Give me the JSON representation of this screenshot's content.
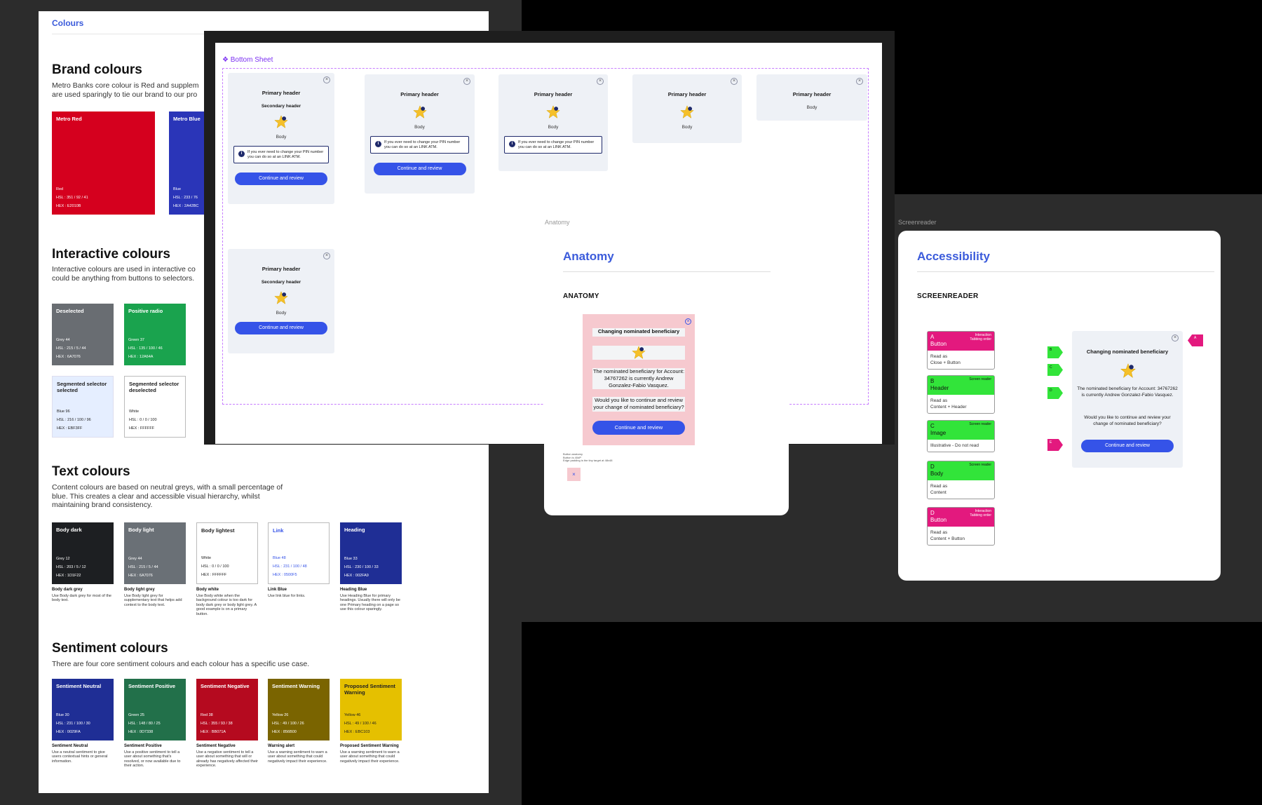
{
  "doc": {
    "tab": "Colours",
    "brand": {
      "title": "Brand colours",
      "desc": "Metro Banks core colour is Red and supplem\nare used sparingly to tie our brand to our pro",
      "swatches": [
        {
          "name": "Metro Red",
          "label": "Red",
          "hsl": "HSL  :  351 / 92 / 41",
          "hex": "HEX  :  E2010B",
          "color": "#d5001e"
        },
        {
          "name": "Metro Blue",
          "label": "Blue",
          "hsl": "HSL  :  233 / 76",
          "hex": "HEX  :  2A42BC",
          "color": "#2a35b8"
        }
      ]
    },
    "interactive": {
      "title": "Interactive colours",
      "desc": "Interactive colours are used in interactive co\ncould be anything from buttons to selectors.",
      "swatches": [
        {
          "name": "Deselected",
          "label": "Grey 44",
          "hsl": "HSL  :  215 / 5 / 44",
          "hex": "HEX  :  6A7076",
          "color": "#696d72"
        },
        {
          "name": "Positive radio",
          "label": "Green 37",
          "hsl": "HSL  :  135 / 100 / 46",
          "hex": "HEX  :  12A64A",
          "color": "#1aa34e"
        },
        {
          "name": "Segmented selector selected",
          "label": "Blue 96",
          "hsl": "HSL  :  216 / 100 / 96",
          "hex": "HEX  :  EBF3FF",
          "color": "#e5eeff"
        },
        {
          "name": "Segmented selector deselected",
          "label": "White",
          "hsl": "HSL  :  0 / 0 / 100",
          "hex": "HEX  :  FFFFFF",
          "color": "#ffffff"
        }
      ]
    },
    "text": {
      "title": "Text colours",
      "desc": "Content colours are based on neutral greys, with a small percentage of\nblue. This creates a clear and accessible visual hierarchy, whilst\nmaintaining brand consistency.",
      "swatches": [
        {
          "name": "Body dark",
          "label": "Grey 12",
          "hsl": "HSL  :  203 / 5 / 12",
          "hex": "HEX  :  1D1F22",
          "color": "#1d1f22",
          "cap_title": "Body dark grey",
          "cap": "Use Body dark grey for most of the body text."
        },
        {
          "name": "Body light",
          "label": "Grey 44",
          "hsl": "HSL  :  215 / 5 / 44",
          "hex": "HEX  :  6A7076",
          "color": "#6a7076",
          "cap_title": "Body light grey",
          "cap": "Use Body light grey for supplementary text that helps add context to the body text."
        },
        {
          "name": "Body lightest",
          "label": "White",
          "hsl": "HSL  :  0 / 0 / 100",
          "hex": "HEX  :  FFFFFF",
          "color": "#ffffff",
          "cap_title": "Body white",
          "cap": "Use Body white when the background colour is too dark for body dark grey or body light grey. A good example is on a primary button."
        },
        {
          "name": "Link",
          "label": "Blue 48",
          "hsl": "HSL  :  231 / 100 / 48",
          "hex": "HEX  :  0500F5",
          "color": "#ffffff",
          "cap_title": "Link Blue",
          "cap": "Use link blue for links."
        },
        {
          "name": "Heading",
          "label": "Blue 33",
          "hsl": "HSL  :  230 / 100 / 33",
          "hex": "HEX  :  002FA9",
          "color": "#1f2e95",
          "cap_title": "Heading Blue",
          "cap": "Use Heading Blue for primary headings. Usually there will only be one Primary heading on a page so use this colour sparingly."
        }
      ]
    },
    "sentiment": {
      "title": "Sentiment colours",
      "desc": "There are four core sentiment colours and each colour has a specific use case.",
      "swatches": [
        {
          "name": "Sentiment Neutral",
          "label": "Blue 30",
          "hsl": "HSL  :  231 / 100 / 30",
          "hex": "HEX  :  0029FA",
          "color": "#1f2e95",
          "cap_title": "Sentiment Neutral",
          "cap": "Use a neutral sentiment to give users contextual hints or general information."
        },
        {
          "name": "Sentiment Positive",
          "label": "Green 25",
          "hsl": "HSL  :  148 / 80 / 25",
          "hex": "HEX  :  0D7338",
          "color": "#22704a",
          "cap_title": "Sentiment Positive",
          "cap": "Use a positive sentiment to tell a user about something that's resolved, or now available due to their action."
        },
        {
          "name": "Sentiment Negative",
          "label": "Red 38",
          "hsl": "HSL  :  355 / 93 / 38",
          "hex": "HEX  :  BB071A",
          "color": "#b50a1f",
          "cap_title": "Sentiment Negative",
          "cap": "Use a negative sentiment to tell a user about something that will or already has negatively affected their experience."
        },
        {
          "name": "Sentiment Warning",
          "label": "Yellow 26",
          "hsl": "HSL  :  49 / 100 / 26",
          "hex": "HEX  :  856B00",
          "color": "#7a6400",
          "cap_title": "Warning alert",
          "cap": "Use a warning sentiment to warn a user about something that could negatively impact their experience."
        },
        {
          "name": "Proposed Sentiment Warning",
          "label": "Yellow 46",
          "hsl": "HSL  :  49 / 100 / 46",
          "hex": "HEX  :  EBC103",
          "color": "#e5c000",
          "cap_title": "Proposed Sentiment Warning",
          "cap": "Use a warning sentiment to warn a user about something that could negatively impact their experience."
        }
      ]
    }
  },
  "bottom_sheet": {
    "label": "Bottom Sheet",
    "primary_header": "Primary header",
    "secondary_header": "Secondary header",
    "body": "Body",
    "info_text": "If you ever need to change your PIN number you can do so at an LINK ATM.",
    "button": "Continue and review",
    "close": "×"
  },
  "anatomy": {
    "frame_label": "Anatomy",
    "title": "Anatomy",
    "subtitle": "ANATOMY",
    "heading": "Changing nominated beneficiary",
    "body1": "The nominated beneficiary for Account: 34767262 is currently Andrew Gonzalez-Fabio Vasquez.",
    "body2": "Would you like to continue and review your change of nominated beneficiary?",
    "button": "Continue and review",
    "notes": "Button anatomy\nButton is 40dP\nEdge padding is the tiny target at 48x48"
  },
  "accessibility": {
    "frame_label": "Screenreader",
    "title": "Accessibility",
    "subtitle": "SCREENREADER",
    "items": [
      {
        "letter": "A",
        "tag": "Interaction\nTabbing order",
        "role": "Button",
        "read_label": "Read as",
        "read_value": "Close + Button",
        "kind": "mag"
      },
      {
        "letter": "B",
        "tag": "Screen reader",
        "role": "Header",
        "read_label": "Read as",
        "read_value": "Content + Header",
        "kind": "grn"
      },
      {
        "letter": "C",
        "tag": "Screen reader",
        "role": "Image",
        "read_label": "",
        "read_value": "Illustrative - Do not read",
        "kind": "grn"
      },
      {
        "letter": "D",
        "tag": "Screen reader",
        "role": "Body",
        "read_label": "Read as",
        "read_value": "Content",
        "kind": "grn"
      },
      {
        "letter": "D",
        "tag": "Interaction\nTabbing order",
        "role": "Button",
        "read_label": "Read as",
        "read_value": "Content + Button",
        "kind": "mag"
      }
    ],
    "heading": "Changing nominated beneficiary",
    "body1": "The nominated beneficiary for Account: 34767262 is currently Andrew Gonzalez-Fabio Vasquez.",
    "body2": "Would you like to continue and review your change of nominated beneficiary?",
    "button": "Continue and review",
    "arrows": [
      "B",
      "C",
      "D",
      "E"
    ],
    "close_arrow": "A"
  }
}
